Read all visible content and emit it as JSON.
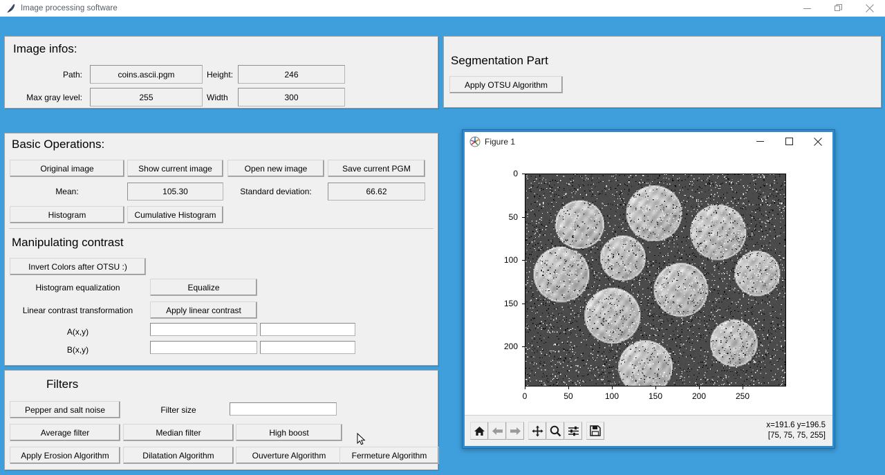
{
  "window": {
    "title": "Image processing software",
    "icon": "feather-icon",
    "controls": {
      "minimize": "minimize-icon",
      "maximize": "restore-icon",
      "close": "close-icon"
    },
    "background_color": "#3f9fdc"
  },
  "image_infos": {
    "heading": "Image infos:",
    "path_label": "Path:",
    "path_value": "coins.ascii.pgm",
    "height_label": "Height:",
    "height_value": "246",
    "max_gray_label": "Max gray level:",
    "max_gray_value": "255",
    "width_label": "Width",
    "width_value": "300"
  },
  "segmentation": {
    "heading": "Segmentation Part",
    "otsu_button": "Apply OTSU Algorithm"
  },
  "basic_operations": {
    "heading": "Basic Operations:",
    "buttons_row1": [
      "Original image",
      "Show current image",
      "Open new image",
      "Save current PGM"
    ],
    "mean_label": "Mean:",
    "mean_value": "105.30",
    "std_label": "Standard deviation:",
    "std_value": "66.62",
    "buttons_row3": [
      "Histogram",
      "Cumulative Histogram"
    ]
  },
  "contrast": {
    "heading": "Manipulating contrast",
    "invert_button": "Invert Colors after OTSU :)",
    "hist_eq_label": "Histogram equalization",
    "equalize_button": "Equalize",
    "linear_label": "Linear contrast transformation",
    "linear_button": "Apply linear contrast",
    "a_label": "A(x,y)",
    "a_value_1": "",
    "a_value_2": "",
    "b_label": "B(x,y)",
    "b_value_1": "",
    "b_value_2": ""
  },
  "filters": {
    "heading": "Filters",
    "noise_button": "Pepper and salt noise",
    "filter_size_label": "Filter size",
    "filter_size_value": "",
    "buttons_row2": [
      "Average filter",
      "Median filter",
      "High boost"
    ],
    "buttons_row3": [
      "Apply Erosion Algorithm",
      "Dilatation Algorithm",
      "Ouverture Algorithm",
      "Fermeture Algorithm"
    ]
  },
  "figure": {
    "title": "Figure 1",
    "icon": "matplotlib-icon",
    "controls": {
      "minimize": "minimize-icon",
      "maximize": "maximize-icon",
      "close": "close-icon"
    },
    "toolbar": [
      {
        "name": "home-icon",
        "label": "Home"
      },
      {
        "name": "back-arrow-icon",
        "label": "Back"
      },
      {
        "name": "forward-arrow-icon",
        "label": "Forward"
      },
      {
        "name": "pan-move-icon",
        "label": "Pan"
      },
      {
        "name": "zoom-magnifier-icon",
        "label": "Zoom"
      },
      {
        "name": "sliders-configure-icon",
        "label": "Configure subplots"
      },
      {
        "name": "save-floppy-icon",
        "label": "Save"
      }
    ],
    "status_line1": "x=191.6 y=196.5",
    "status_line2": "[75, 75, 75, 255]"
  },
  "chart_data": {
    "type": "heatmap",
    "title": "",
    "xlabel": "",
    "ylabel": "",
    "description": "Grayscale coins image with salt-and-pepper noise displayed via imshow",
    "xlim": [
      0,
      300
    ],
    "ylim": [
      246,
      0
    ],
    "xticks": [
      0,
      50,
      100,
      150,
      200,
      250
    ],
    "yticks": [
      0,
      50,
      100,
      150,
      200
    ],
    "grid": false,
    "legend": "none",
    "colormap": "gray",
    "vmin": 0,
    "vmax": 255,
    "background_gray": 75,
    "noise": {
      "type": "salt-and-pepper",
      "density": 0.06
    },
    "coins": [
      {
        "cx": 62,
        "cy": 58,
        "r": 29
      },
      {
        "cx": 148,
        "cy": 45,
        "r": 33
      },
      {
        "cx": 222,
        "cy": 67,
        "r": 33
      },
      {
        "cx": 112,
        "cy": 97,
        "r": 27
      },
      {
        "cx": 41,
        "cy": 116,
        "r": 33
      },
      {
        "cx": 179,
        "cy": 134,
        "r": 32
      },
      {
        "cx": 267,
        "cy": 115,
        "r": 27
      },
      {
        "cx": 100,
        "cy": 164,
        "r": 33
      },
      {
        "cx": 240,
        "cy": 196,
        "r": 28
      },
      {
        "cx": 138,
        "cy": 224,
        "r": 32
      }
    ]
  }
}
